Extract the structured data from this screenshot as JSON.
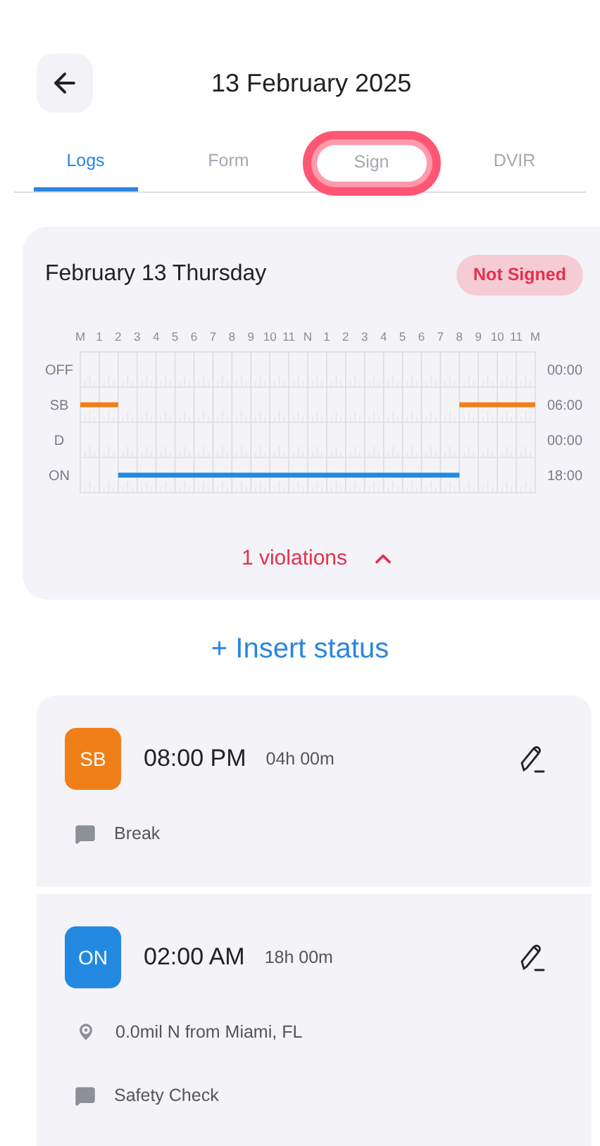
{
  "header": {
    "title": "13 February 2025"
  },
  "tabs": [
    {
      "label": "Logs",
      "selected": true,
      "highlighted": false
    },
    {
      "label": "Form",
      "selected": false,
      "highlighted": false
    },
    {
      "label": "Sign",
      "selected": false,
      "highlighted": true
    },
    {
      "label": "DVIR",
      "selected": false,
      "highlighted": false
    }
  ],
  "log_card": {
    "date": "February 13 Thursday",
    "badge": "Not Signed",
    "hour_labels": [
      "M",
      "1",
      "2",
      "3",
      "4",
      "5",
      "6",
      "7",
      "8",
      "9",
      "10",
      "11",
      "N",
      "1",
      "2",
      "3",
      "4",
      "5",
      "6",
      "7",
      "8",
      "9",
      "10",
      "11",
      "M"
    ],
    "rows": [
      {
        "label": "OFF",
        "total": "00:00"
      },
      {
        "label": "SB",
        "total": "06:00"
      },
      {
        "label": "D",
        "total": "00:00"
      },
      {
        "label": "ON",
        "total": "18:00"
      }
    ],
    "violations": "1 violations"
  },
  "insert_button": "+ Insert status",
  "entries": [
    {
      "status": "SB",
      "color": "#f07f1a",
      "time": "08:00 PM",
      "duration": "04h 00m",
      "details": [
        {
          "kind": "note",
          "text": "Break"
        }
      ]
    },
    {
      "status": "ON",
      "color": "#2389e0",
      "time": "02:00 AM",
      "duration": "18h 00m",
      "details": [
        {
          "kind": "location",
          "text": "0.0mil N from Miami, FL"
        },
        {
          "kind": "note",
          "text": "Safety Check"
        }
      ]
    }
  ]
}
